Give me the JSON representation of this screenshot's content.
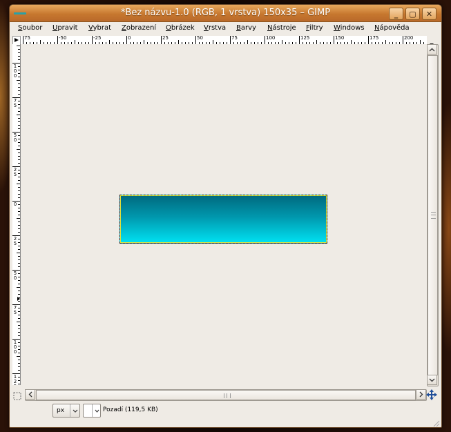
{
  "window": {
    "title": "*Bez názvu-1.0 (RGB, 1 vrstva) 150x35 – GIMP"
  },
  "titlebar_buttons": [
    {
      "name": "minimize",
      "glyph": "_"
    },
    {
      "name": "maximize",
      "glyph": "▢"
    },
    {
      "name": "close",
      "glyph": "✕"
    }
  ],
  "menu": [
    "Soubor",
    "Upravit",
    "Vybrat",
    "Zobrazení",
    "Obrázek",
    "Vrstva",
    "Barvy",
    "Nástroje",
    "Filtry",
    "Windows",
    "Nápověda"
  ],
  "ruler": {
    "horizontal_labels": [
      "75",
      "-50",
      "-25",
      "0",
      "25",
      "50",
      "75",
      "100",
      "125",
      "150",
      "175",
      "200"
    ],
    "vertical_labels": [
      "100",
      "75",
      "50",
      "25",
      "0",
      "25",
      "50",
      "75",
      "100",
      "125"
    ]
  },
  "image": {
    "gradient_top": "#00697e",
    "gradient_bottom": "#00e2f2"
  },
  "statusbar": {
    "unit": "px",
    "layer_info": "Pozadí (119,5 KB)"
  },
  "icons": {
    "quick_mask": "quick-mask-icon",
    "navigate": "navigate-icon"
  }
}
